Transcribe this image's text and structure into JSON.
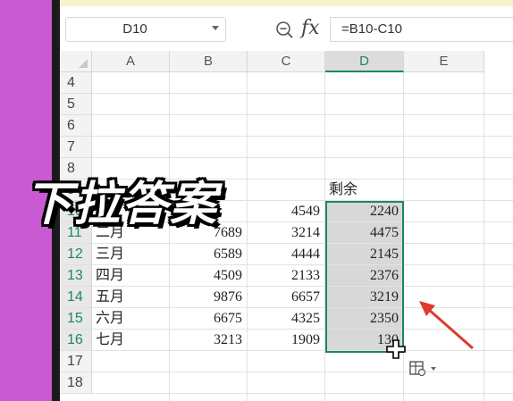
{
  "name_box": {
    "value": "D10"
  },
  "formula_bar": {
    "formula": "=B10-C10",
    "fx_label": "fx"
  },
  "columns": [
    "A",
    "B",
    "C",
    "D",
    "E"
  ],
  "selected_column": "D",
  "rows": [
    {
      "num": "4",
      "A": "",
      "B": "",
      "C": "",
      "D": ""
    },
    {
      "num": "5",
      "A": "",
      "B": "",
      "C": "",
      "D": ""
    },
    {
      "num": "6",
      "A": "",
      "B": "",
      "C": "",
      "D": ""
    },
    {
      "num": "7",
      "A": "",
      "B": "",
      "C": "",
      "D": ""
    },
    {
      "num": "8",
      "A": "",
      "B": "",
      "C": "",
      "D": ""
    },
    {
      "num": "9",
      "A": "",
      "B": "",
      "C": "",
      "D": "剩余"
    },
    {
      "num": "10",
      "A": "",
      "B": "",
      "C": "4549",
      "D": "2240"
    },
    {
      "num": "11",
      "A": "二月",
      "B": "7689",
      "C": "3214",
      "D": "4475"
    },
    {
      "num": "12",
      "A": "三月",
      "B": "6589",
      "C": "4444",
      "D": "2145"
    },
    {
      "num": "13",
      "A": "四月",
      "B": "4509",
      "C": "2133",
      "D": "2376"
    },
    {
      "num": "14",
      "A": "五月",
      "B": "9876",
      "C": "6657",
      "D": "3219"
    },
    {
      "num": "15",
      "A": "六月",
      "B": "6675",
      "C": "4325",
      "D": "2350"
    },
    {
      "num": "16",
      "A": "七月",
      "B": "3213",
      "C": "1909",
      "D": "130"
    },
    {
      "num": "17",
      "A": "",
      "B": "",
      "C": "",
      "D": ""
    },
    {
      "num": "18",
      "A": "",
      "B": "",
      "C": "",
      "D": ""
    }
  ],
  "selected_rows": [
    "10",
    "11",
    "12",
    "13",
    "14",
    "15",
    "16"
  ],
  "overlay_caption": "下拉答案",
  "colors": {
    "accent": "#1b8a5a",
    "arrow": "#e0392f",
    "sidebar": "#c95ad3"
  }
}
